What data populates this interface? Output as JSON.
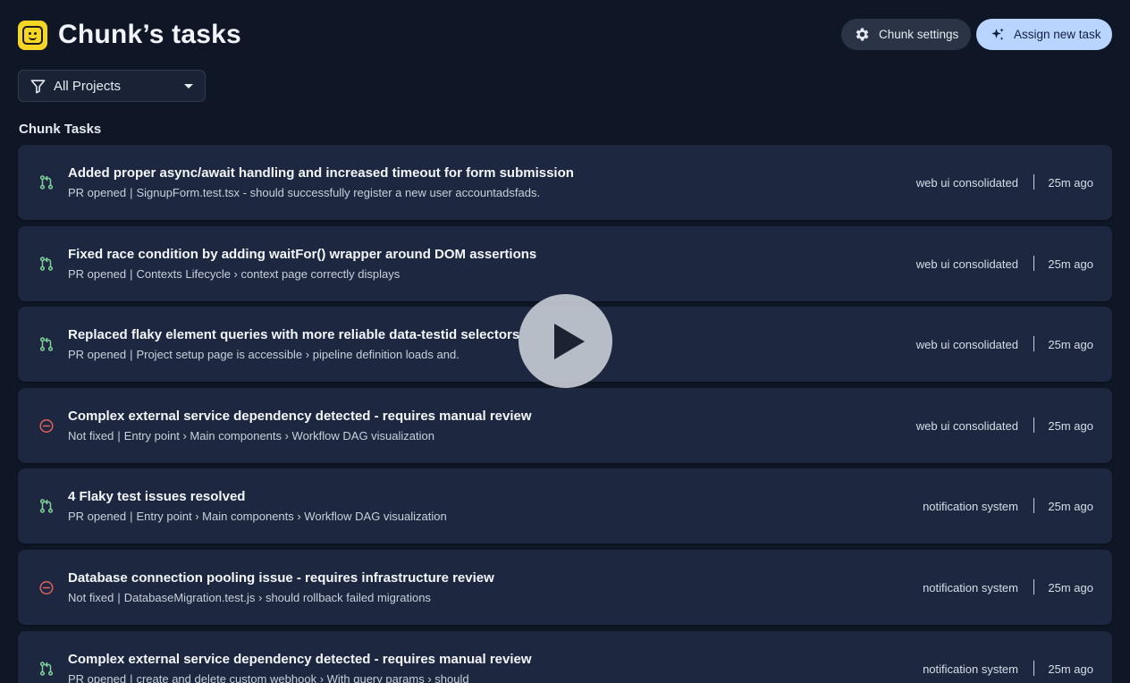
{
  "header": {
    "title": "Chunk’s tasks",
    "settings_label": "Chunk settings",
    "assign_label": "Assign new task",
    "settings_icon": "gear-icon",
    "assign_icon": "sparkles-icon",
    "logo_icon": "chunk-logo-icon"
  },
  "filter": {
    "selected": "All Projects",
    "icon": "funnel-icon"
  },
  "section": {
    "title": "Chunk Tasks"
  },
  "colors": {
    "background": "#0f1626",
    "card": "#1d2840",
    "pr_icon": "#7fd39a",
    "not_fixed_icon": "#e0605e",
    "assign_button": "#b9d4ff",
    "logo": "#f6d624"
  },
  "tasks": [
    {
      "status": "pr",
      "title": "Added proper async/await handling and increased timeout for form submission",
      "state": "PR opened",
      "detail": "SignupForm.test.tsx - should successfully register a new user accountadsfads.",
      "project": "web ui consolidated",
      "time": "25m ago"
    },
    {
      "status": "pr",
      "title": "Fixed race condition by adding waitFor() wrapper around DOM assertions",
      "state": "PR opened",
      "detail": "Contexts Lifecycle › context page correctly displays",
      "project": "web ui consolidated",
      "time": "25m ago"
    },
    {
      "status": "pr",
      "title": "Replaced flaky element queries with more reliable data-testid selectors",
      "state": "PR opened",
      "detail": "Project setup page is accessible › pipeline definition loads and.",
      "project": "web ui consolidated",
      "time": "25m ago"
    },
    {
      "status": "not_fixed",
      "title": "Complex external service dependency detected - requires manual review",
      "state": "Not fixed",
      "detail": "Entry point › Main components › Workflow DAG visualization",
      "project": "web ui consolidated",
      "time": "25m ago"
    },
    {
      "status": "pr",
      "title": "4 Flaky test issues resolved",
      "state": "PR opened",
      "detail": "Entry point › Main components › Workflow DAG visualization",
      "project": "notification system",
      "time": "25m ago"
    },
    {
      "status": "not_fixed",
      "title": "Database connection pooling issue - requires infrastructure review",
      "state": "Not fixed",
      "detail": "DatabaseMigration.test.js › should rollback failed migrations",
      "project": "notification system",
      "time": "25m ago"
    },
    {
      "status": "pr",
      "title": "Complex external service dependency detected - requires manual review",
      "state": "PR opened",
      "detail": "create and delete custom webhook › With query params › should",
      "project": "notification system",
      "time": "25m ago"
    }
  ],
  "overlay": {
    "icon": "play-icon"
  }
}
